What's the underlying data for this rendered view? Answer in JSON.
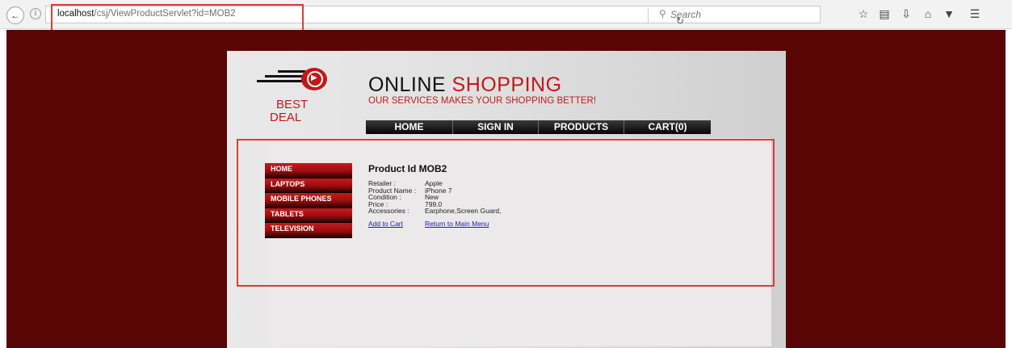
{
  "browser": {
    "url_host": "localhost",
    "url_path": "/csj/ViewProductServlet?id=MOB2",
    "search_placeholder": "Search"
  },
  "site": {
    "brand_line1": "BEST",
    "brand_line2": "DEAL",
    "title_part1": "ONLINE",
    "title_part2": "SHOPPING",
    "tagline": "OUR SERVICES MAKES YOUR SHOPPING BETTER!"
  },
  "topnav": [
    "HOME",
    "SIGN IN",
    "PRODUCTS",
    "CART(0)"
  ],
  "catnav": [
    "HOME",
    "LAPTOPS",
    "MOBILE PHONES",
    "TABLETS",
    "TELEVISION"
  ],
  "product": {
    "title": "Product Id MOB2",
    "details": [
      {
        "label": "Retailer :",
        "value": "Apple"
      },
      {
        "label": "Product Name :",
        "value": "iPhone 7"
      },
      {
        "label": "Condition :",
        "value": "New"
      },
      {
        "label": "Price :",
        "value": "799.0"
      },
      {
        "label": "Accessories :",
        "value": "Earphone,Screen Guard,"
      }
    ],
    "add_to_cart": "Add to Cart",
    "return_main": "Return to Main Menu"
  },
  "colors": {
    "page_bg": "#5a0505",
    "brand_red": "#c0191b",
    "annotation_red": "#e0393a"
  }
}
